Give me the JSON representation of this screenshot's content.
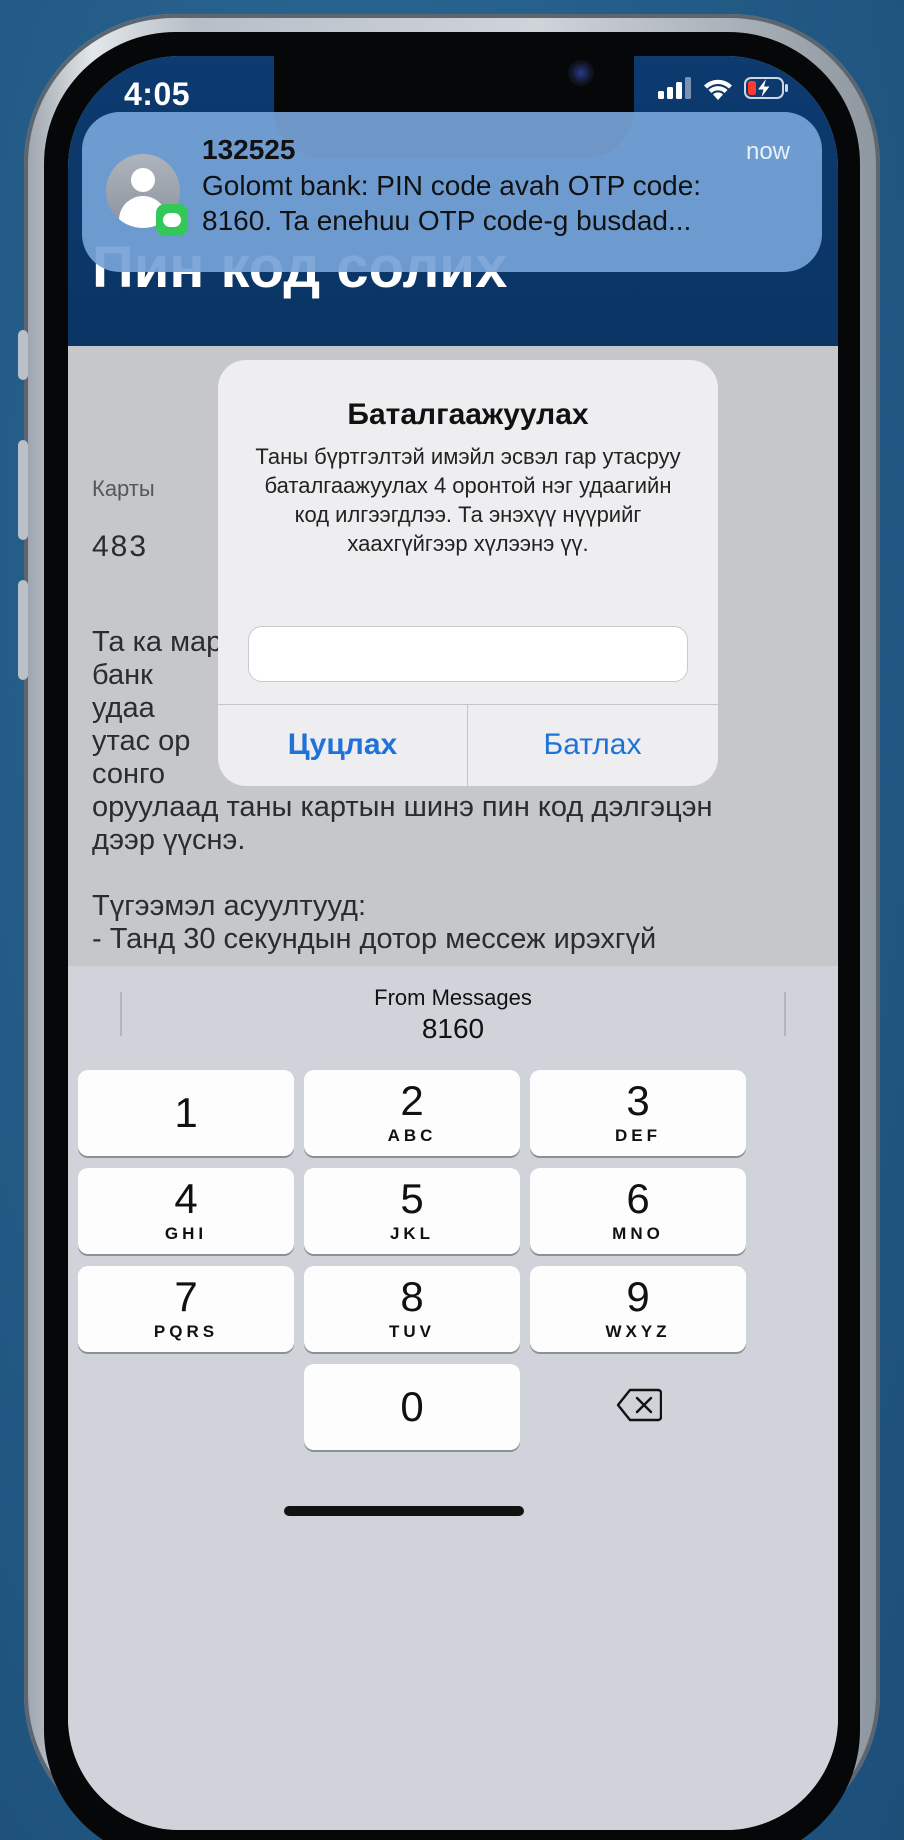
{
  "status_bar": {
    "time": "4:05"
  },
  "header": {
    "title": "Пин код солих"
  },
  "notification": {
    "sender": "132525",
    "time": "now",
    "body": "Golomt bank: PIN code avah OTP code:\n8160. Ta enehuu OTP code-g busdad..."
  },
  "content": {
    "card_label": "Карты",
    "card_number": "483",
    "paragraph_lines": [
      "Та ка                                         март",
      "банк",
      "удаа",
      "утас                                             ор",
      "сонго",
      "оруулаад таны картын шинэ пин код дэлгэцэн",
      "дээр үүснэ.",
      "",
      "Түгээмэл асуултууд:",
      "   - Танд 30 секундын дотор мессеж ирэхгүй"
    ]
  },
  "alert": {
    "title": "Баталгаажуулах",
    "message": "Таны бүртгэлтэй имэйл эсвэл гар утасруу баталгаажуулах 4 оронтой нэг удаагийн код илгээгдлээ. Та энэхүү нүүрийг хаахгүйгээр хүлээнэ үү.",
    "input_value": "",
    "cancel_label": "Цуцлах",
    "confirm_label": "Батлах"
  },
  "keyboard": {
    "suggestion_source": "From Messages",
    "suggestion_code": "8160",
    "keys": [
      {
        "digit": "1",
        "letters": ""
      },
      {
        "digit": "2",
        "letters": "ABC"
      },
      {
        "digit": "3",
        "letters": "DEF"
      },
      {
        "digit": "4",
        "letters": "GHI"
      },
      {
        "digit": "5",
        "letters": "JKL"
      },
      {
        "digit": "6",
        "letters": "MNO"
      },
      {
        "digit": "7",
        "letters": "PQRS"
      },
      {
        "digit": "8",
        "letters": "TUV"
      },
      {
        "digit": "9",
        "letters": "WXYZ"
      },
      {
        "digit": "0",
        "letters": ""
      }
    ]
  },
  "icons": {
    "signal": "signal-icon",
    "wifi": "wifi-icon",
    "battery": "battery-charging-icon",
    "delete": "delete-key-icon",
    "messages": "messages-icon",
    "avatar": "contact-avatar-icon"
  },
  "colors": {
    "header_bg": "#0d3a6f",
    "notification_bg": "#76a3d7",
    "alert_button": "#1e72d8",
    "battery_low": "#ff3b30",
    "keyboard_bg": "#d0d3da"
  }
}
